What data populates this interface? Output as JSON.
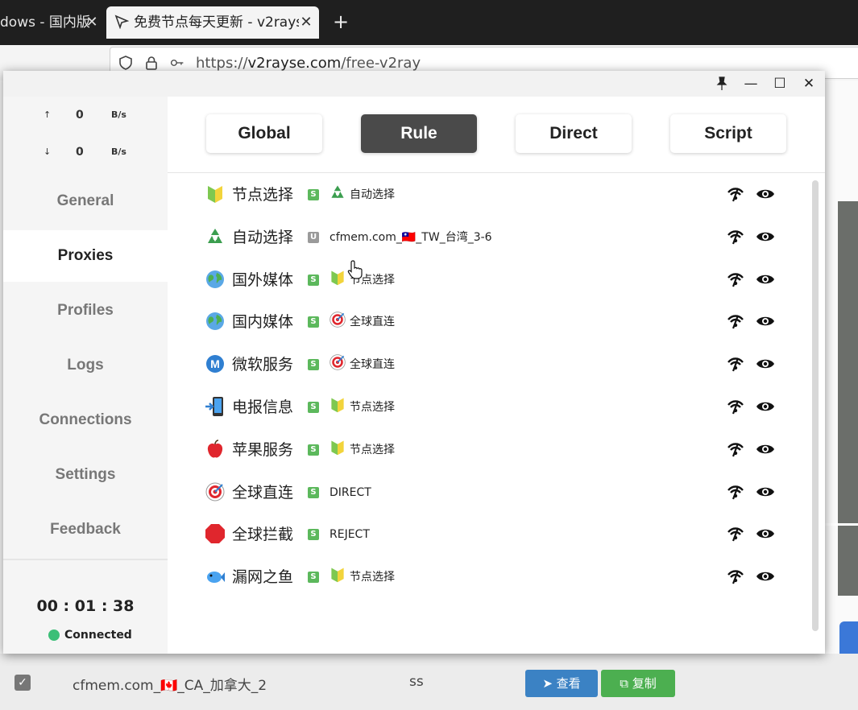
{
  "browser": {
    "inactive_tab_title": "dows - 国内版",
    "active_tab_title": "免费节点每天更新 - v2rays",
    "tab_close_label": "✕",
    "new_tab_label": "+",
    "url_prefix": "https://",
    "url_domain": "v2rayse.com",
    "url_path": "/free-v2ray"
  },
  "background_page": {
    "node_name": "cfmem.com_🇨🇦_CA_加拿大_2",
    "node_type": "ss",
    "view_button": "➤ 查看",
    "copy_button": "⧉ 复制",
    "checkbox_mark": "✓"
  },
  "window_controls": {
    "pin": "📌",
    "minimize": "—",
    "maximize": "☐",
    "close": "✕"
  },
  "traffic": {
    "upload_arrow": "↑",
    "upload_value": "0",
    "upload_unit": "B/s",
    "download_arrow": "↓",
    "download_value": "0",
    "download_unit": "B/s"
  },
  "nav": [
    "General",
    "Proxies",
    "Profiles",
    "Logs",
    "Connections",
    "Settings",
    "Feedback"
  ],
  "active_nav": "Proxies",
  "session": {
    "timer": "00 : 01 : 38",
    "status": "Connected",
    "status_color": "#3bbf77"
  },
  "modes": [
    "Global",
    "Rule",
    "Direct",
    "Script"
  ],
  "active_mode": "Rule",
  "groups": [
    {
      "icon": "beginner-icon",
      "name": "节点选择",
      "badge": "S",
      "selected_icon": "recycle-icon",
      "selected": "自动选择"
    },
    {
      "icon": "recycle-icon",
      "name": "自动选择",
      "badge": "U",
      "selected_icon": "",
      "selected": "cfmem.com_🇹🇼_TW_台湾_3-6"
    },
    {
      "icon": "globe-icon",
      "name": "国外媒体",
      "badge": "S",
      "selected_icon": "beginner-icon",
      "selected": "节点选择"
    },
    {
      "icon": "globe-icon",
      "name": "国内媒体",
      "badge": "S",
      "selected_icon": "target-icon",
      "selected": "全球直连"
    },
    {
      "icon": "metro-icon",
      "name": "微软服务",
      "badge": "S",
      "selected_icon": "target-icon",
      "selected": "全球直连"
    },
    {
      "icon": "phone-icon",
      "name": "电报信息",
      "badge": "S",
      "selected_icon": "beginner-icon",
      "selected": "节点选择"
    },
    {
      "icon": "apple-icon",
      "name": "苹果服务",
      "badge": "S",
      "selected_icon": "beginner-icon",
      "selected": "节点选择"
    },
    {
      "icon": "target-icon",
      "name": "全球直连",
      "badge": "S",
      "selected_icon": "",
      "selected": "DIRECT"
    },
    {
      "icon": "stop-icon",
      "name": "全球拦截",
      "badge": "S",
      "selected_icon": "",
      "selected": "REJECT"
    },
    {
      "icon": "fish-icon",
      "name": "漏网之鱼",
      "badge": "S",
      "selected_icon": "beginner-icon",
      "selected": "节点选择"
    }
  ]
}
